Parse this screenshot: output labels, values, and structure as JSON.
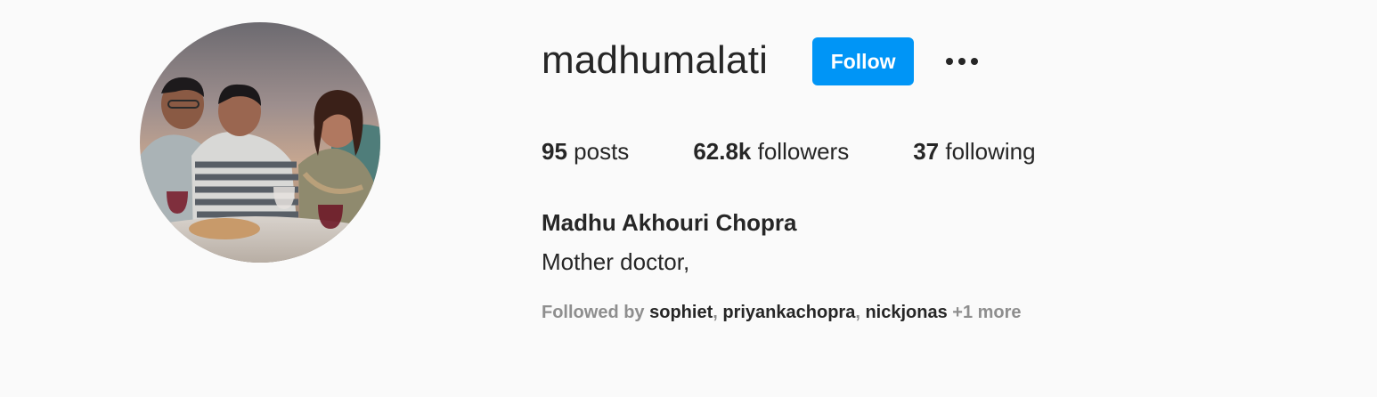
{
  "profile": {
    "username": "madhumalati",
    "follow_label": "Follow",
    "more_icon": "ellipsis-icon",
    "stats": {
      "posts_count": "95",
      "posts_label": "posts",
      "followers_count": "62.8k",
      "followers_label": "followers",
      "following_count": "37",
      "following_label": "following"
    },
    "full_name": "Madhu Akhouri Chopra",
    "bio": "Mother doctor,",
    "followed_by": {
      "prefix": "Followed by",
      "users": [
        "sophiet",
        "priyankachopra",
        "nickjonas"
      ],
      "separator": ", ",
      "more": "+1 more"
    }
  },
  "colors": {
    "accent": "#0095f6",
    "background": "#fafafa",
    "text_primary": "#262626",
    "text_secondary": "#8e8e8e"
  }
}
